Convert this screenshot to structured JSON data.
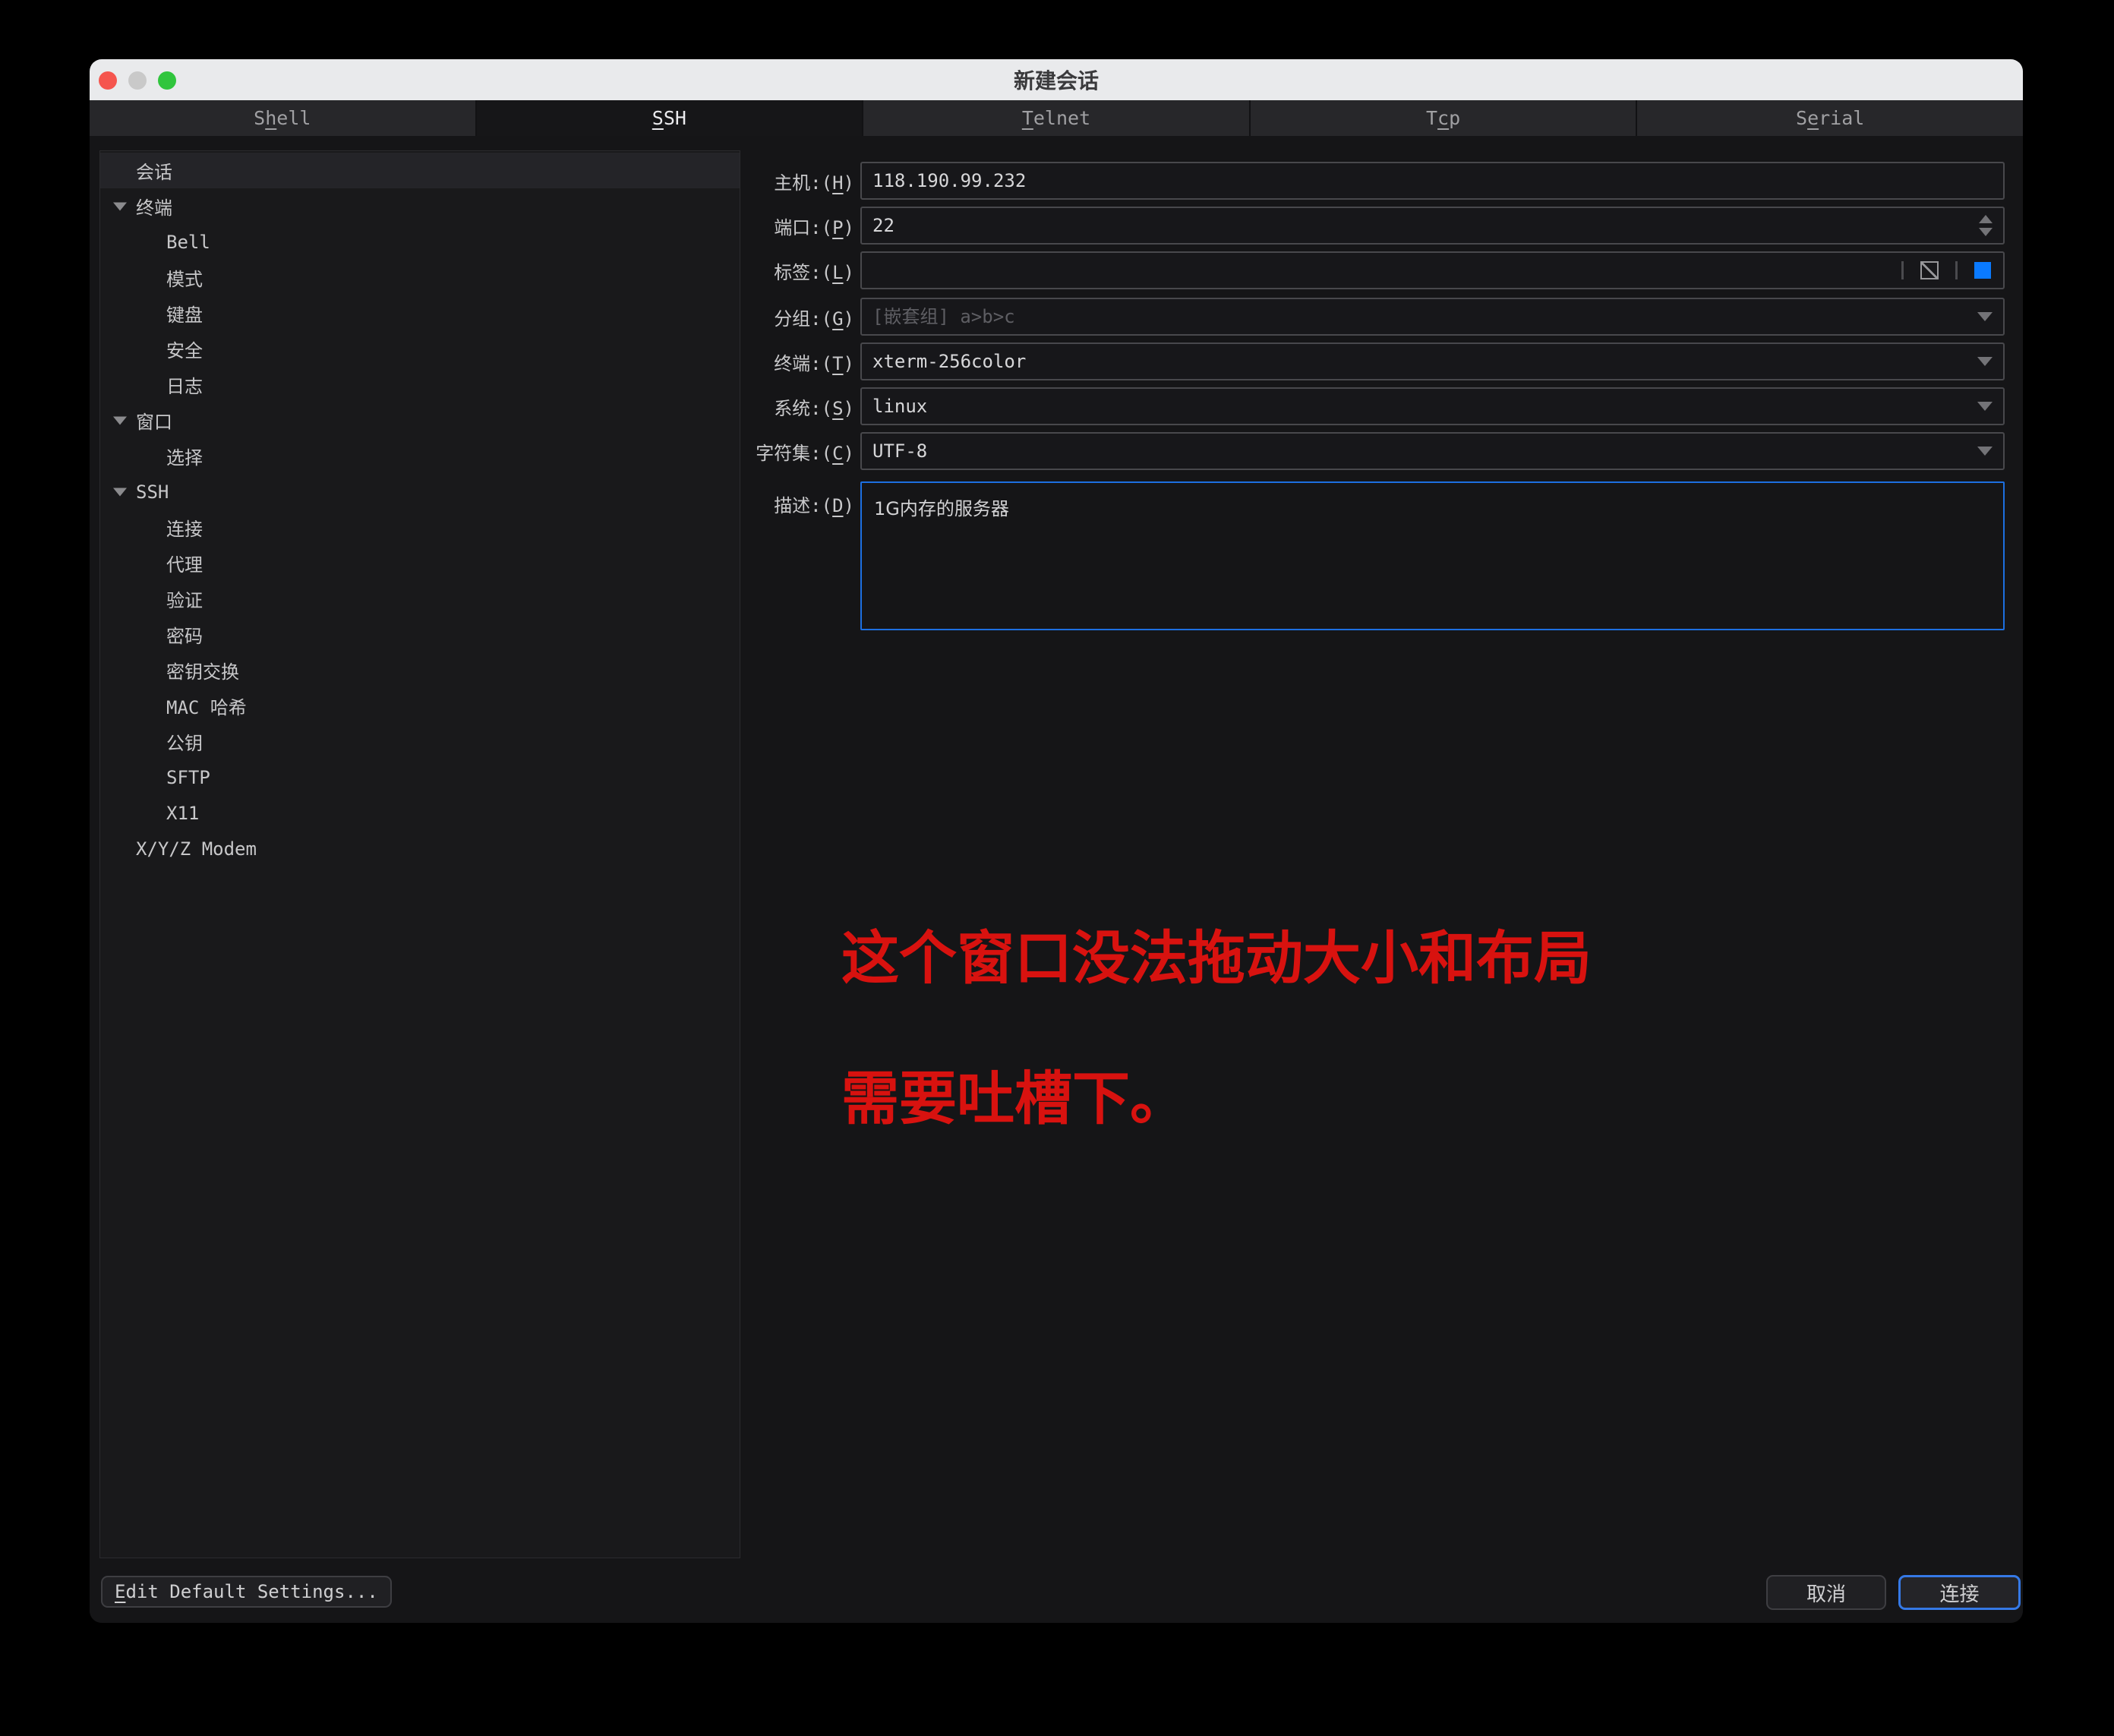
{
  "window": {
    "title": "新建会话"
  },
  "titlebar": {
    "buttons": [
      "close",
      "minimize",
      "zoom"
    ],
    "colors": {
      "close": "#f5554e",
      "minimize": "#c9c9c9",
      "zoom": "#30c53d"
    }
  },
  "tabs": [
    {
      "pre": "S",
      "key": "h",
      "post": "ell",
      "selected": false
    },
    {
      "pre": "",
      "key": "S",
      "post": "SH",
      "selected": true
    },
    {
      "pre": "",
      "key": "T",
      "post": "elnet",
      "selected": false
    },
    {
      "pre": "T",
      "key": "c",
      "post": "p",
      "selected": false
    },
    {
      "pre": "S",
      "key": "e",
      "post": "rial",
      "selected": false
    }
  ],
  "sidebar": {
    "items": [
      {
        "label": "会话",
        "type": "top",
        "selected": true
      },
      {
        "label": "终端",
        "type": "group",
        "selected": false
      },
      {
        "label": "Bell",
        "type": "child",
        "selected": false
      },
      {
        "label": "模式",
        "type": "child",
        "selected": false
      },
      {
        "label": "键盘",
        "type": "child",
        "selected": false
      },
      {
        "label": "安全",
        "type": "child",
        "selected": false
      },
      {
        "label": "日志",
        "type": "child",
        "selected": false
      },
      {
        "label": "窗口",
        "type": "group",
        "selected": false
      },
      {
        "label": "选择",
        "type": "child",
        "selected": false
      },
      {
        "label": "SSH",
        "type": "group",
        "selected": false
      },
      {
        "label": "连接",
        "type": "child",
        "selected": false
      },
      {
        "label": "代理",
        "type": "child",
        "selected": false
      },
      {
        "label": "验证",
        "type": "child",
        "selected": false
      },
      {
        "label": "密码",
        "type": "child",
        "selected": false
      },
      {
        "label": "密钥交换",
        "type": "child",
        "selected": false
      },
      {
        "label": "MAC 哈希",
        "type": "child",
        "selected": false
      },
      {
        "label": "公钥",
        "type": "child",
        "selected": false
      },
      {
        "label": "SFTP",
        "type": "child",
        "selected": false
      },
      {
        "label": "X11",
        "type": "child",
        "selected": false
      },
      {
        "label": "X/Y/Z Modem",
        "type": "top",
        "selected": false
      }
    ]
  },
  "form": {
    "rows": [
      {
        "label_pre": "主机:(",
        "label_key": "H",
        "label_post": ")",
        "value": "118.190.99.232",
        "control": "text"
      },
      {
        "label_pre": "端口:(",
        "label_key": "P",
        "label_post": ")",
        "value": "22",
        "control": "spinner"
      },
      {
        "label_pre": "标签:(",
        "label_key": "L",
        "label_post": ")",
        "value": "",
        "control": "color-swatches"
      },
      {
        "label_pre": "分组:(",
        "label_key": "G",
        "label_post": ")",
        "value": "",
        "placeholder": "[嵌套组] a>b>c",
        "control": "combo"
      },
      {
        "label_pre": "终端:(",
        "label_key": "T",
        "label_post": ")",
        "value": "xterm-256color",
        "control": "select"
      },
      {
        "label_pre": "系统:(",
        "label_key": "S",
        "label_post": ")",
        "value": "linux",
        "control": "select"
      },
      {
        "label_pre": "字符集:(",
        "label_key": "C",
        "label_post": ")",
        "value": "UTF-8",
        "control": "select"
      },
      {
        "label_pre": "描述:(",
        "label_key": "D",
        "label_post": ")",
        "value": "1G内存的服务器",
        "control": "textarea"
      }
    ],
    "tag_swatch_color": "#0a7aff",
    "description_focus_border": "#1d6fe0"
  },
  "annotation": {
    "line1": "这个窗口没法拖动大小和布局",
    "line2": "需要吐槽下。",
    "color": "#d8120f"
  },
  "footer": {
    "edit_default": {
      "pre": "",
      "key": "E",
      "post": "dit Default Settings..."
    },
    "cancel": "取消",
    "connect": "连接",
    "connect_border": "#3579e6"
  }
}
